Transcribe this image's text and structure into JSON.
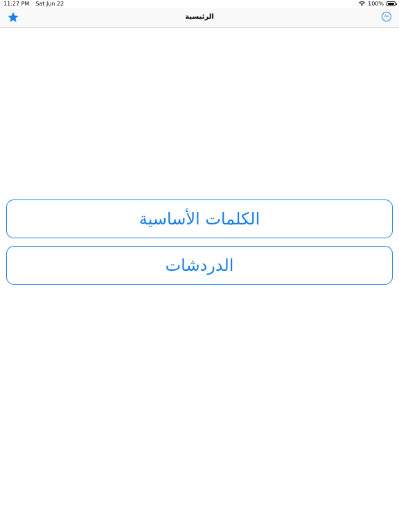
{
  "status_bar": {
    "time": "11:27 PM",
    "date": "Sat Jun 22",
    "battery_percent": "100%",
    "wifi_icon": "wifi-icon",
    "battery_icon": "battery-icon"
  },
  "nav": {
    "title": "الرئيسية",
    "left_icon": "star-icon",
    "right_icon": "language-icon",
    "right_icon_text": "Aa"
  },
  "buttons": [
    {
      "label": "الكلمات الأساسية"
    },
    {
      "label": "الدردشات"
    }
  ],
  "colors": {
    "accent": "#1a7fe6",
    "background": "#ffffff"
  }
}
